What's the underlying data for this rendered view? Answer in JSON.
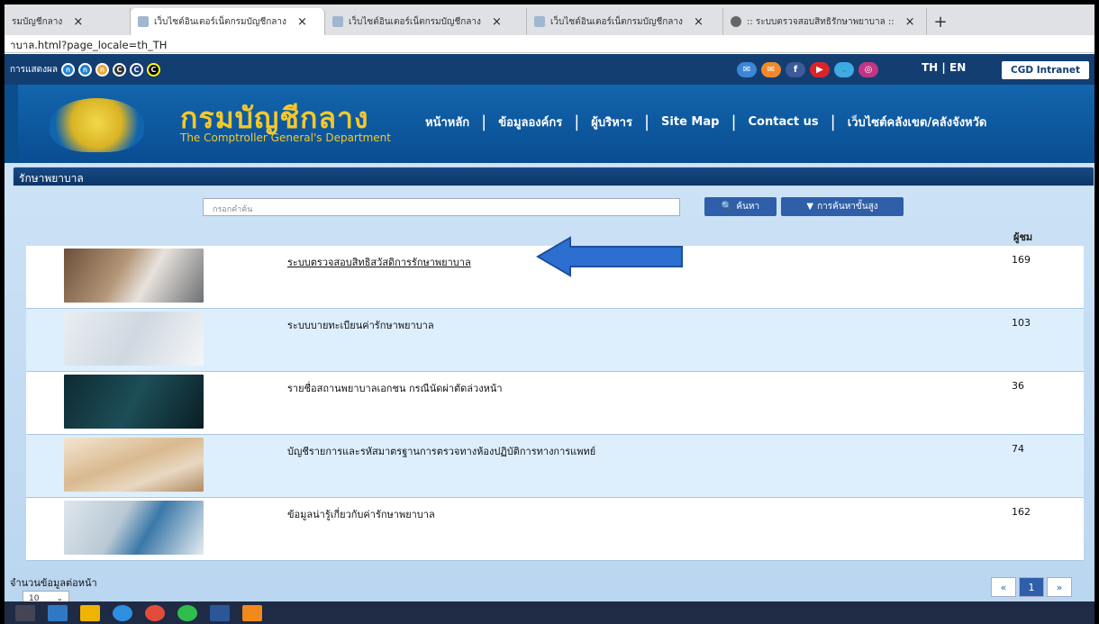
{
  "browser": {
    "tabs": [
      {
        "label": "รมบัญชีกลาง",
        "active": false
      },
      {
        "label": "เว็บไซต์อินเตอร์เน็ตกรมบัญชีกลาง",
        "active": true
      },
      {
        "label": "เว็บไซต์อินเตอร์เน็ตกรมบัญชีกลาง",
        "active": false
      },
      {
        "label": "เว็บไซต์อินเตอร์เน็ตกรมบัญชีกลาง",
        "active": false
      },
      {
        "label": ":: ระบบตรวจสอบสิทธิรักษาพยาบาล ::",
        "active": false
      }
    ],
    "close_glyph": "×",
    "new_tab_glyph": "+",
    "url": "าบาล.html?page_locale=th_TH"
  },
  "topstrip": {
    "display_label": "การแสดงผล",
    "font_size_dots": [
      "ก",
      "ก",
      "ก"
    ],
    "contrast_dots": [
      "C",
      "C",
      "C"
    ],
    "social": [
      {
        "icon": "email-icon",
        "color": "#3d86d6"
      },
      {
        "icon": "mail-icon",
        "color": "#f0892c"
      },
      {
        "icon": "facebook-icon",
        "color": "#3b5b99",
        "glyph": "f"
      },
      {
        "icon": "youtube-icon",
        "color": "#d9252a",
        "glyph": "▶"
      },
      {
        "icon": "twitter-icon",
        "color": "#3fa8e6"
      },
      {
        "icon": "instagram-icon",
        "color": "#c13584"
      }
    ],
    "lang_th": "TH",
    "lang_sep": "|",
    "lang_en": "EN",
    "intranet": "CGD Intranet"
  },
  "header": {
    "brand_th": "กรมบัญชีกลาง",
    "brand_en": "The Comptroller General's Department",
    "nav": [
      "หน้าหลัก",
      "ข้อมูลองค์กร",
      "ผู้บริหาร",
      "Site Map",
      "Contact us",
      "เว็บไซต์คลังเขต/คลังจังหวัด"
    ],
    "nav_sep": "|"
  },
  "section": {
    "title": "รักษาพยาบาล",
    "search_placeholder": "กรอกคำค้น",
    "search_label": "ค้นหา",
    "advanced_label": "การค้นหาขั้นสูง",
    "views_header": "ผู้ชม"
  },
  "items": [
    {
      "title": "ระบบตรวจสอบสิทธิสวัสดิการรักษาพยาบาล",
      "views": "169",
      "linked": true,
      "thumb": "stethoscope"
    },
    {
      "title": "ระบบบายทะเบียนค่ารักษาพยาบาล",
      "views": "103",
      "linked": false,
      "thumb": "writing"
    },
    {
      "title": "รายชื่อสถานพยาบาลเอกชน กรณีนัดผ่าตัดล่วงหน้า",
      "views": "36",
      "linked": false,
      "thumb": "surgery"
    },
    {
      "title": "บัญชีรายการและรหัสมาตรฐานการตรวจทางห้องปฏิบัติการทางการแพทย์",
      "views": "74",
      "linked": false,
      "thumb": "papers"
    },
    {
      "title": "ข้อมูลน่ารู้เกี่ยวกับค่ารักษาพยาบาล",
      "views": "162",
      "linked": false,
      "thumb": "desk"
    }
  ],
  "footer": {
    "per_page_label": "จำนวนข้อมูลต่อหน้า",
    "per_page_value": "10",
    "pager": [
      "«",
      "1",
      "»"
    ]
  },
  "colors": {
    "navy": "#133e72",
    "header_blue": "#1265ad",
    "gold": "#f3c82b",
    "arrow": "#2d6fd0"
  }
}
